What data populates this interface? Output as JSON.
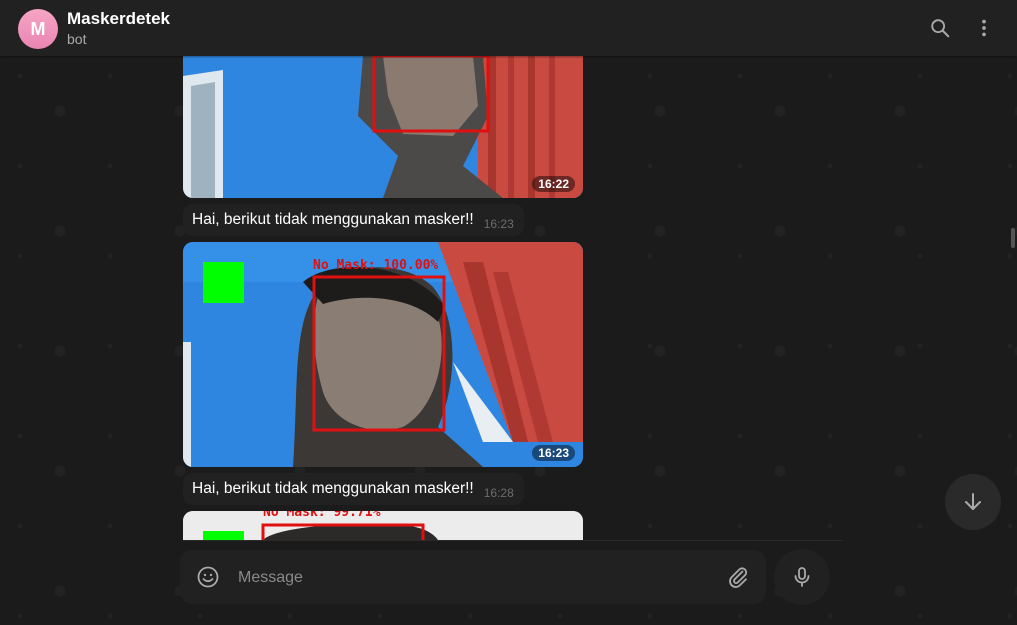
{
  "header": {
    "avatar_letter": "M",
    "title": "Maskerdetek",
    "subtitle": "bot",
    "search_icon": "search-icon",
    "menu_icon": "more-vertical-icon"
  },
  "messages": [
    {
      "type": "photo",
      "time": "16:22"
    },
    {
      "type": "text",
      "text": "Hai, berikut tidak menggunakan masker!!",
      "time": "16:23"
    },
    {
      "type": "photo",
      "time": "16:23",
      "label": "No Mask: 100.00%"
    },
    {
      "type": "text",
      "text": "Hai, berikut tidak menggunakan masker!!",
      "time": "16:28"
    },
    {
      "type": "photo",
      "label": "No Mask: 99.71%"
    }
  ],
  "composer": {
    "placeholder": "Message",
    "emoji_icon": "smile-icon",
    "attach_icon": "paperclip-icon",
    "mic_icon": "microphone-icon"
  },
  "colors": {
    "accent_avatar": "#f29bc0",
    "detection_box": "#e01010",
    "indicator_green": "#00ff00"
  }
}
